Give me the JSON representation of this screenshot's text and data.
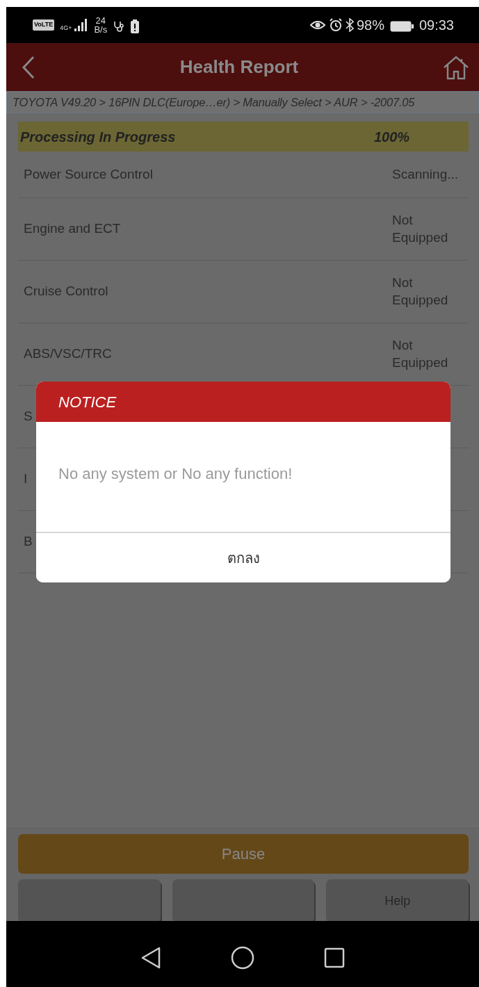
{
  "status_bar": {
    "volte": "VoLTE",
    "network": "4G+",
    "speed": "24",
    "speed_unit": "B/s",
    "battery": "98%",
    "time": "09:33"
  },
  "header": {
    "title": "Health Report"
  },
  "breadcrumb": "TOYOTA V49.20 > 16PIN DLC(Europe…er) > Manually Select > AUR > -2007.05",
  "progress": {
    "label": "Processing In Progress",
    "value": "100%",
    "level": 1
  },
  "systems": [
    {
      "name": "Power Source Control",
      "status": "Scanning..."
    },
    {
      "name": "Engine and ECT",
      "status": "Not Equipped"
    },
    {
      "name": "Cruise Control",
      "status": "Not Equipped"
    },
    {
      "name": "ABS/VSC/TRC",
      "status": "Not Equipped"
    },
    {
      "name": "S"
    },
    {
      "name": "I"
    },
    {
      "name": "B"
    }
  ],
  "buttons": {
    "primary": "Pause",
    "secondary": [
      {
        "kind": "blank"
      },
      {
        "kind": "blank"
      },
      {
        "kind": "labeled",
        "label": "Help"
      }
    ]
  },
  "dialog": {
    "title": "NOTICE",
    "message": "No any system or No any function!",
    "button": "ตกลง"
  }
}
